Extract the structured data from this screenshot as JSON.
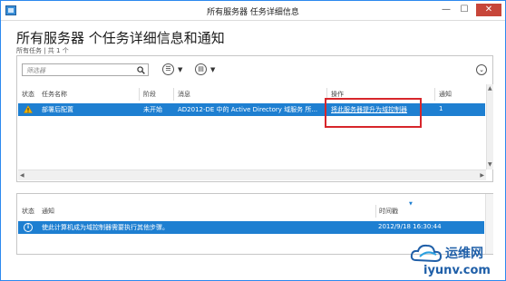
{
  "window": {
    "title": "所有服务器 任务详细信息",
    "minimize": "—",
    "maximize": "☐",
    "close": "✕"
  },
  "page": {
    "title": "所有服务器 个任务详细信息和通知",
    "subtitle": "所有任务 | 共 1 个"
  },
  "toolbar": {
    "filter_placeholder": "筛选器",
    "view_glyph": "☰",
    "group_glyph": "▤",
    "dropdown_glyph": "▼",
    "collapse_glyph": "⌄"
  },
  "tasks": {
    "headers": {
      "status": "状态",
      "task_name": "任务名称",
      "stage": "阶段",
      "message": "消息",
      "action": "操作",
      "notification": "通知"
    },
    "rows": [
      {
        "task_name": "部署后配置",
        "stage": "未开始",
        "message": "AD2012-DE 中的 Active Directory 域服务 所...",
        "action": "将此服务器提升为域控制器",
        "notification": "1"
      }
    ]
  },
  "notifications": {
    "headers": {
      "status": "状态",
      "notification": "通知",
      "timestamp": "时间戳"
    },
    "rows": [
      {
        "notification": "使此计算机成为域控制器需要执行其他步骤。",
        "timestamp": "2012/9/18 16:30:44"
      }
    ]
  },
  "watermark": {
    "cn": "运维网",
    "en": "iyunv.com"
  },
  "colors": {
    "selection": "#1e7fd1",
    "highlight": "#d7262b",
    "warning": "#f2b100"
  }
}
